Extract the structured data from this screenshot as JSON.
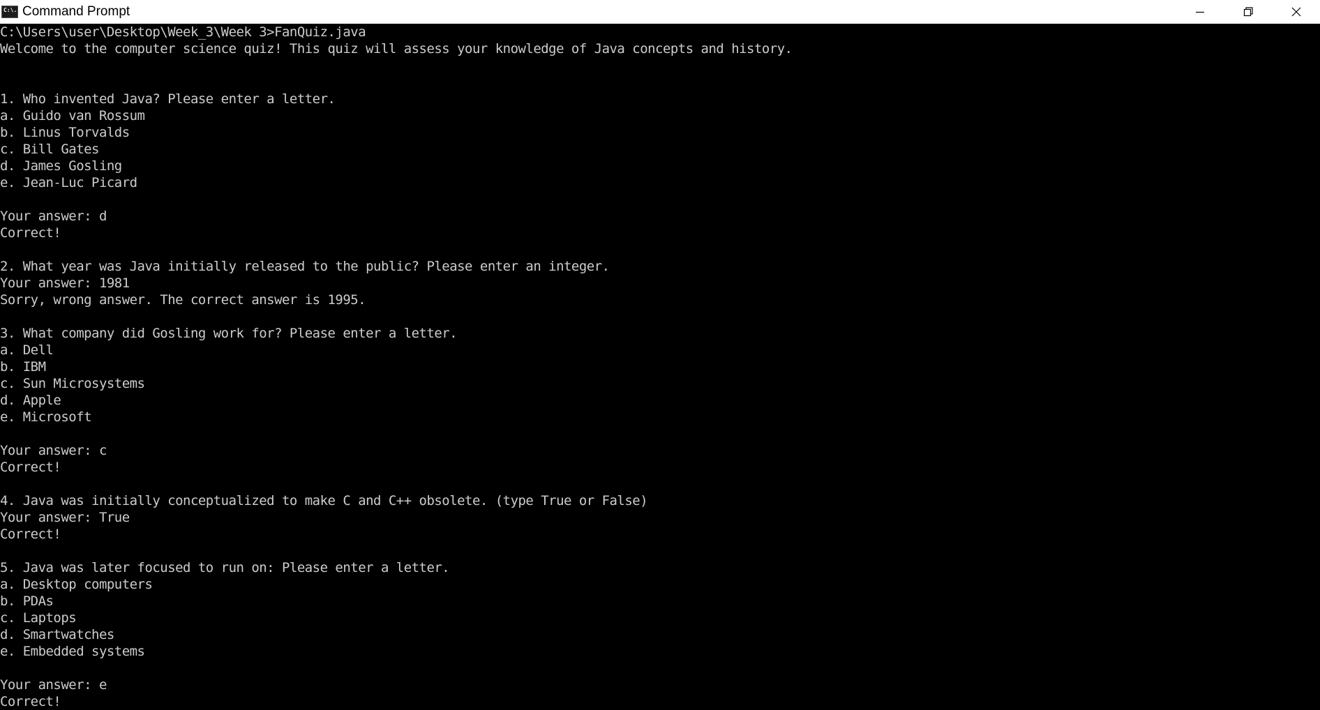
{
  "window": {
    "title": "Command Prompt",
    "app_icon": "cmd-icon",
    "app_icon_text": "C:\\.",
    "controls": [
      "minimize-icon",
      "restore-icon",
      "close-icon"
    ]
  },
  "colors": {
    "titlebar_bg": "#ffffff",
    "console_bg": "#000000",
    "console_text": "#cccccc"
  },
  "console": {
    "lines": [
      "C:\\Users\\user\\Desktop\\Week_3\\Week 3>FanQuiz.java",
      "Welcome to the computer science quiz! This quiz will assess your knowledge of Java concepts and history.",
      "",
      "",
      "1. Who invented Java? Please enter a letter.",
      "a. Guido van Rossum",
      "b. Linus Torvalds",
      "c. Bill Gates",
      "d. James Gosling",
      "e. Jean-Luc Picard",
      "",
      "Your answer: d",
      "Correct!",
      "",
      "2. What year was Java initially released to the public? Please enter an integer.",
      "Your answer: 1981",
      "Sorry, wrong answer. The correct answer is 1995.",
      "",
      "3. What company did Gosling work for? Please enter a letter.",
      "a. Dell",
      "b. IBM",
      "c. Sun Microsystems",
      "d. Apple",
      "e. Microsoft",
      "",
      "Your answer: c",
      "Correct!",
      "",
      "4. Java was initially conceptualized to make C and C++ obsolete. (type True or False)",
      "Your answer: True",
      "Correct!",
      "",
      "5. Java was later focused to run on: Please enter a letter.",
      "a. Desktop computers",
      "b. PDAs",
      "c. Laptops",
      "d. Smartwatches",
      "e. Embedded systems",
      "",
      "Your answer: e",
      "Correct!"
    ]
  }
}
